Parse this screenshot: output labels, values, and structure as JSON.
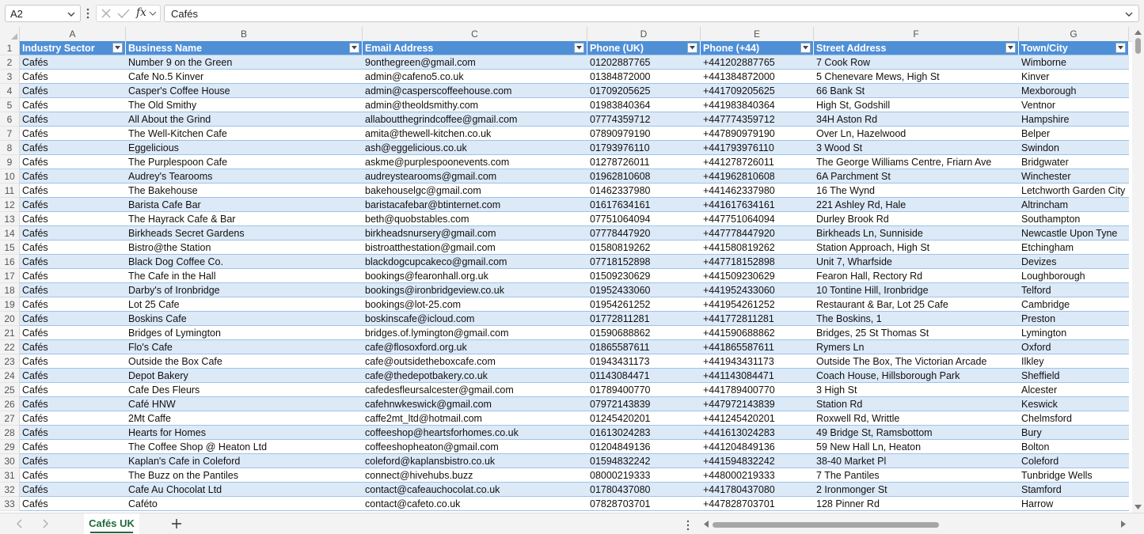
{
  "formula_bar": {
    "name_box": "A2",
    "formula": "Cafés",
    "fx_label": "fx"
  },
  "columns": [
    {
      "letter": "A"
    },
    {
      "letter": "B"
    },
    {
      "letter": "C"
    },
    {
      "letter": "D"
    },
    {
      "letter": "E"
    },
    {
      "letter": "F"
    },
    {
      "letter": "G"
    }
  ],
  "header": {
    "row_number": "1",
    "cells": [
      "Industry Sector",
      "Business Name",
      "Email Address",
      "Phone (UK)",
      "Phone (+44)",
      "Street Address",
      "Town/City"
    ]
  },
  "rows": [
    {
      "n": "2",
      "cells": [
        "Cafés",
        "Number 9 on the Green",
        "9onthegreen@gmail.com",
        "01202887765",
        "+441202887765",
        "7 Cook Row",
        "Wimborne"
      ]
    },
    {
      "n": "3",
      "cells": [
        "Cafés",
        "Cafe No.5 Kinver",
        "admin@cafeno5.co.uk",
        "01384872000",
        "+441384872000",
        "5 Chenevare Mews, High St",
        "Kinver"
      ]
    },
    {
      "n": "4",
      "cells": [
        "Cafés",
        "Casper's Coffee House",
        "admin@casperscoffeehouse.com",
        "01709205625",
        "+441709205625",
        "66 Bank St",
        "Mexborough"
      ]
    },
    {
      "n": "5",
      "cells": [
        "Cafés",
        "The Old Smithy",
        "admin@theoldsmithy.com",
        "01983840364",
        "+441983840364",
        "High St, Godshill",
        "Ventnor"
      ]
    },
    {
      "n": "6",
      "cells": [
        "Cafés",
        "All About the Grind",
        "allaboutthegrindcoffee@gmail.com",
        "07774359712",
        "+447774359712",
        "34H Aston Rd",
        "Hampshire"
      ]
    },
    {
      "n": "7",
      "cells": [
        "Cafés",
        "The Well-Kitchen Cafe",
        "amita@thewell-kitchen.co.uk",
        "07890979190",
        "+447890979190",
        "Over Ln, Hazelwood",
        "Belper"
      ]
    },
    {
      "n": "8",
      "cells": [
        "Cafés",
        "Eggelicious",
        "ash@eggelicious.co.uk",
        "01793976110",
        "+441793976110",
        "3 Wood St",
        "Swindon"
      ]
    },
    {
      "n": "9",
      "cells": [
        "Cafés",
        "The Purplespoon Cafe",
        "askme@purplespoonevents.com",
        "01278726011",
        "+441278726011",
        "The George Williams Centre, Friarn Ave",
        "Bridgwater"
      ]
    },
    {
      "n": "10",
      "cells": [
        "Cafés",
        "Audrey's Tearooms",
        "audreystearooms@gmail.com",
        "01962810608",
        "+441962810608",
        "6A Parchment St",
        "Winchester"
      ]
    },
    {
      "n": "11",
      "cells": [
        "Cafés",
        "The Bakehouse",
        "bakehouselgc@gmail.com",
        "01462337980",
        "+441462337980",
        "16 The Wynd",
        "Letchworth Garden City"
      ]
    },
    {
      "n": "12",
      "cells": [
        "Cafés",
        "Barista Cafe Bar",
        "baristacafebar@btinternet.com",
        "01617634161",
        "+441617634161",
        "221 Ashley Rd, Hale",
        "Altrincham"
      ]
    },
    {
      "n": "13",
      "cells": [
        "Cafés",
        "The Hayrack Cafe & Bar",
        "beth@quobstables.com",
        "07751064094",
        "+447751064094",
        "Durley Brook Rd",
        "Southampton"
      ]
    },
    {
      "n": "14",
      "cells": [
        "Cafés",
        "Birkheads Secret Gardens",
        "birkheadsnursery@gmail.com",
        "07778447920",
        "+447778447920",
        "Birkheads Ln, Sunniside",
        "Newcastle Upon Tyne"
      ]
    },
    {
      "n": "15",
      "cells": [
        "Cafés",
        "Bistro@the Station",
        "bistroatthestation@gmail.com",
        "01580819262",
        "+441580819262",
        "Station Approach, High St",
        "Etchingham"
      ]
    },
    {
      "n": "16",
      "cells": [
        "Cafés",
        "Black Dog Coffee Co.",
        "blackdogcupcakeco@gmail.com",
        "07718152898",
        "+447718152898",
        "Unit 7, Wharfside",
        "Devizes"
      ]
    },
    {
      "n": "17",
      "cells": [
        "Cafés",
        "The Cafe in the Hall",
        "bookings@fearonhall.org.uk",
        "01509230629",
        "+441509230629",
        "Fearon Hall, Rectory Rd",
        "Loughborough"
      ]
    },
    {
      "n": "18",
      "cells": [
        "Cafés",
        "Darby's of Ironbridge",
        "bookings@ironbridgeview.co.uk",
        "01952433060",
        "+441952433060",
        "10 Tontine Hill, Ironbridge",
        "Telford"
      ]
    },
    {
      "n": "19",
      "cells": [
        "Cafés",
        "Lot 25 Cafe",
        "bookings@lot-25.com",
        "01954261252",
        "+441954261252",
        "Restaurant & Bar, Lot 25 Cafe",
        "Cambridge"
      ]
    },
    {
      "n": "20",
      "cells": [
        "Cafés",
        "Boskins Cafe",
        "boskinscafe@icloud.com",
        "01772811281",
        "+441772811281",
        "The Boskins, 1",
        "Preston"
      ]
    },
    {
      "n": "21",
      "cells": [
        "Cafés",
        "Bridges of Lymington",
        "bridges.of.lymington@gmail.com",
        "01590688862",
        "+441590688862",
        "Bridges, 25 St Thomas St",
        "Lymington"
      ]
    },
    {
      "n": "22",
      "cells": [
        "Cafés",
        "Flo's Cafe",
        "cafe@flosoxford.org.uk",
        "01865587611",
        "+441865587611",
        "Rymers Ln",
        "Oxford"
      ]
    },
    {
      "n": "23",
      "cells": [
        "Cafés",
        "Outside the Box Cafe",
        "cafe@outsidetheboxcafe.com",
        "01943431173",
        "+441943431173",
        "Outside The Box, The Victorian Arcade",
        "Ilkley"
      ]
    },
    {
      "n": "24",
      "cells": [
        "Cafés",
        "Depot Bakery",
        "cafe@thedepotbakery.co.uk",
        "01143084471",
        "+441143084471",
        "Coach House, Hillsborough Park",
        "Sheffield"
      ]
    },
    {
      "n": "25",
      "cells": [
        "Cafés",
        "Cafe Des Fleurs",
        "cafedesfleursalcester@gmail.com",
        "01789400770",
        "+441789400770",
        "3 High St",
        "Alcester"
      ]
    },
    {
      "n": "26",
      "cells": [
        "Cafés",
        "Café HNW",
        "cafehnwkeswick@gmail.com",
        "07972143839",
        "+447972143839",
        "Station Rd",
        "Keswick"
      ]
    },
    {
      "n": "27",
      "cells": [
        "Cafés",
        "2Mt Caffe",
        "caffe2mt_ltd@hotmail.com",
        "01245420201",
        "+441245420201",
        "Roxwell Rd, Writtle",
        "Chelmsford"
      ]
    },
    {
      "n": "28",
      "cells": [
        "Cafés",
        "Hearts for Homes",
        "coffeeshop@heartsforhomes.co.uk",
        "01613024283",
        "+441613024283",
        "49 Bridge St, Ramsbottom",
        "Bury"
      ]
    },
    {
      "n": "29",
      "cells": [
        "Cafés",
        "The Coffee Shop @ Heaton Ltd",
        "coffeeshopheaton@gmail.com",
        "01204849136",
        "+441204849136",
        "59 New Hall Ln, Heaton",
        "Bolton"
      ]
    },
    {
      "n": "30",
      "cells": [
        "Cafés",
        "Kaplan's Cafe in Coleford",
        "coleford@kaplansbistro.co.uk",
        "01594832242",
        "+441594832242",
        "38-40 Market Pl",
        "Coleford"
      ]
    },
    {
      "n": "31",
      "cells": [
        "Cafés",
        "The Buzz on the Pantiles",
        "connect@hivehubs.buzz",
        "08000219333",
        "+448000219333",
        "7 The Pantiles",
        "Tunbridge Wells"
      ]
    },
    {
      "n": "32",
      "cells": [
        "Cafés",
        "Cafe Au Chocolat Ltd",
        "contact@cafeauchocolat.co.uk",
        "01780437080",
        "+441780437080",
        "2 Ironmonger St",
        "Stamford"
      ]
    },
    {
      "n": "33",
      "cells": [
        "Cafés",
        "Caféto",
        "contact@cafeto.co.uk",
        "07828703701",
        "+447828703701",
        "128 Pinner Rd",
        "Harrow"
      ]
    }
  ],
  "sheet_tabs": [
    {
      "label": "Cafés UK",
      "active": true
    }
  ],
  "colors": {
    "header_fill": "#4f8fd6",
    "band_fill": "#dce9f7",
    "tab_accent": "#1e6b3a"
  }
}
